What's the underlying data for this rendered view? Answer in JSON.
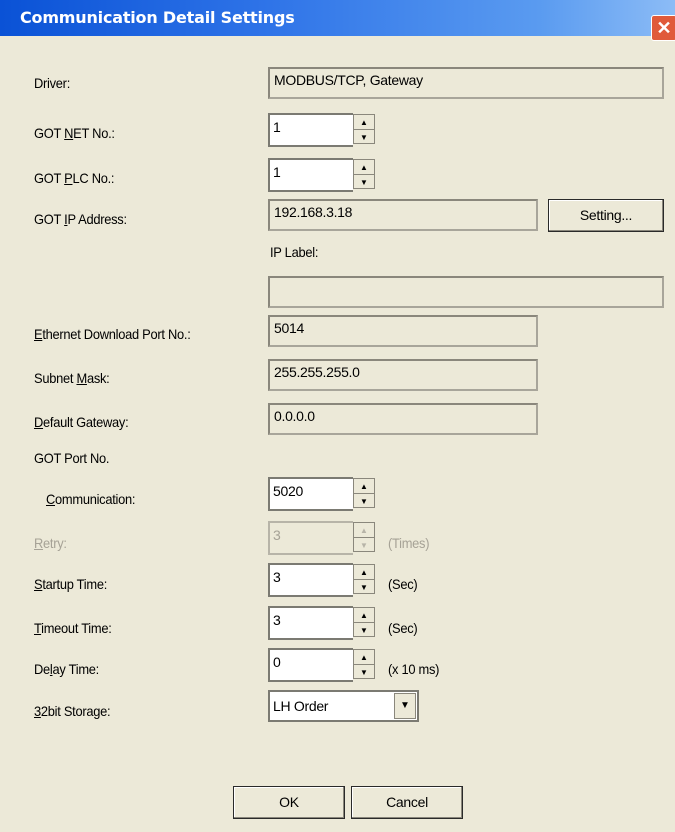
{
  "window": {
    "title": "Communication Detail Settings",
    "close_glyph": "✕"
  },
  "fields": {
    "driver": {
      "label_pre": "Driver:",
      "value": "MODBUS/TCP, Gateway"
    },
    "got_net_no": {
      "label_pre": "GOT ",
      "label_key": "N",
      "label_post": "ET No.:",
      "value": "1"
    },
    "got_plc_no": {
      "label_pre": "GOT ",
      "label_key": "P",
      "label_post": "LC No.:",
      "value": "1"
    },
    "got_ip_address": {
      "label_pre": "GOT ",
      "label_key": "I",
      "label_post": "P Address:",
      "value": "192.168.3.18",
      "setting_button": "Setting..."
    },
    "ip_label": {
      "label": "IP Label:",
      "value": ""
    },
    "ethernet_download_port": {
      "label_key": "E",
      "label_post": "thernet Download Port No.:",
      "value": "5014"
    },
    "subnet_mask": {
      "label_pre": "Subnet ",
      "label_key": "M",
      "label_post": "ask:",
      "value": "255.255.255.0"
    },
    "default_gateway": {
      "label_key": "D",
      "label_post": "efault Gateway:",
      "value": "0.0.0.0"
    },
    "got_port_no": {
      "label": "GOT Port No."
    },
    "communication": {
      "label_key": "C",
      "label_post": "ommunication:",
      "value": "5020"
    },
    "retry": {
      "label_key": "R",
      "label_post": "etry:",
      "value": "3",
      "unit": "(Times)"
    },
    "startup_time": {
      "label_key": "S",
      "label_post": "tartup Time:",
      "value": "3",
      "unit": "(Sec)"
    },
    "timeout_time": {
      "label_key": "T",
      "label_post": "imeout Time:",
      "value": "3",
      "unit": "(Sec)"
    },
    "delay_time": {
      "label_pre": "De",
      "label_key": "l",
      "label_post": "ay Time:",
      "value": "0",
      "unit": "(x 10 ms)"
    },
    "storage_32bit": {
      "label_key": "3",
      "label_post": "2bit Storage:",
      "value": "LH Order"
    }
  },
  "buttons": {
    "ok": "OK",
    "cancel": "Cancel"
  },
  "icons": {
    "spin_up": "▲",
    "spin_down": "▼",
    "dropdown": "▼"
  }
}
